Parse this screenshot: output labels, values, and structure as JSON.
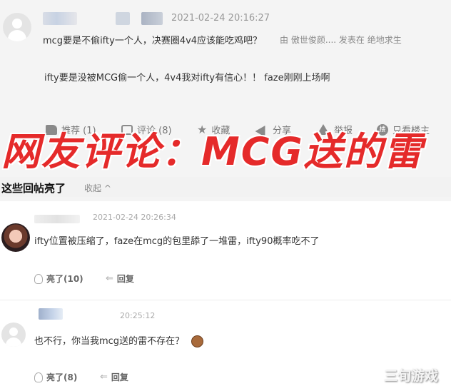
{
  "post": {
    "timestamp": "2021-02-24 20:16:27",
    "quote_line": "mcg要是不偷ifty一个人，决赛圈4v4应该能吃鸡吧？",
    "quote_from": "由 傲世俊颜.... 发表在 绝地求生",
    "body": "ifty要是没被MCG偷一个人，4v4我对ifty有信心！！ faze刚刚上场啊",
    "actions": {
      "recommend": "推荐 (1)",
      "comment": "评论 (8)",
      "favorite": "收藏",
      "share": "分享",
      "report": "举报",
      "only_op": "只看楼主"
    },
    "icons": {
      "only_op_badge": "楼"
    }
  },
  "banner": {
    "text": "网友评论：MCG送的雷",
    "color": "#e52a2a"
  },
  "replies_section": {
    "title": "这些回帖亮了",
    "collapse": "收起 ^"
  },
  "replies": [
    {
      "timestamp": "2021-02-24 20:26:34",
      "text": "ifty位置被压缩了，faze在mcg的包里舔了一堆雷，ifty90概率吃不了",
      "light": "亮了(10)",
      "reply": "回复"
    },
    {
      "timestamp": "20:25:12",
      "text": "也不行，你当我mcg送的雷不存在？",
      "light": "亮了(8)",
      "reply": "回复"
    }
  ],
  "watermark": "三旬游戏"
}
